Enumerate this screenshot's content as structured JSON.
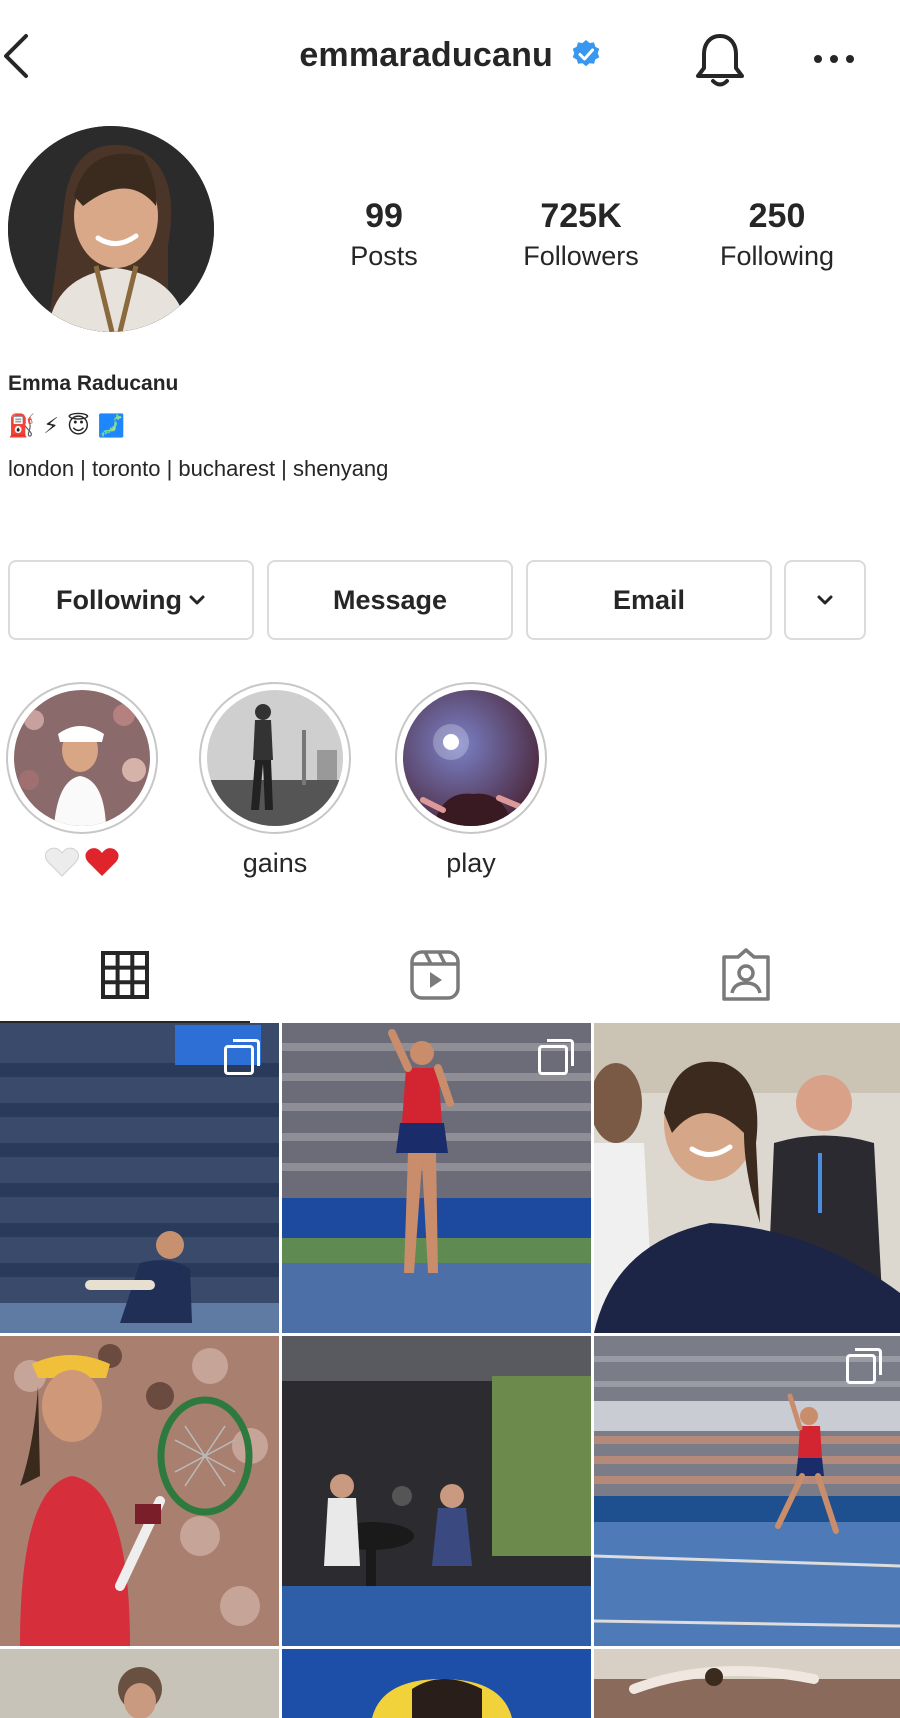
{
  "header": {
    "username": "emmaraducanu",
    "verified_icon": "verified-badge-icon",
    "bell_icon": "bell-icon",
    "more_icon": "more-horizontal-icon",
    "back_icon": "chevron-left-icon"
  },
  "profile": {
    "stats": [
      {
        "value": "99",
        "label": "Posts"
      },
      {
        "value": "725K",
        "label": "Followers"
      },
      {
        "value": "250",
        "label": "Following"
      }
    ],
    "name": "Emma Raducanu",
    "emoji_line": [
      "⛽",
      "⚡",
      "😇",
      "🗾"
    ],
    "cities": "london | toronto | bucharest | shenyang"
  },
  "buttons": {
    "following": "Following",
    "message": "Message",
    "email": "Email"
  },
  "highlights": [
    {
      "label": "",
      "hearts": [
        "🤍",
        "❤️"
      ]
    },
    {
      "label": "gains"
    },
    {
      "label": "play"
    }
  ],
  "tabs": [
    "grid-icon",
    "reels-icon",
    "tagged-icon"
  ],
  "colors": {
    "verified": "#3897f0",
    "border": "#dbdbdb",
    "text": "#262626"
  }
}
